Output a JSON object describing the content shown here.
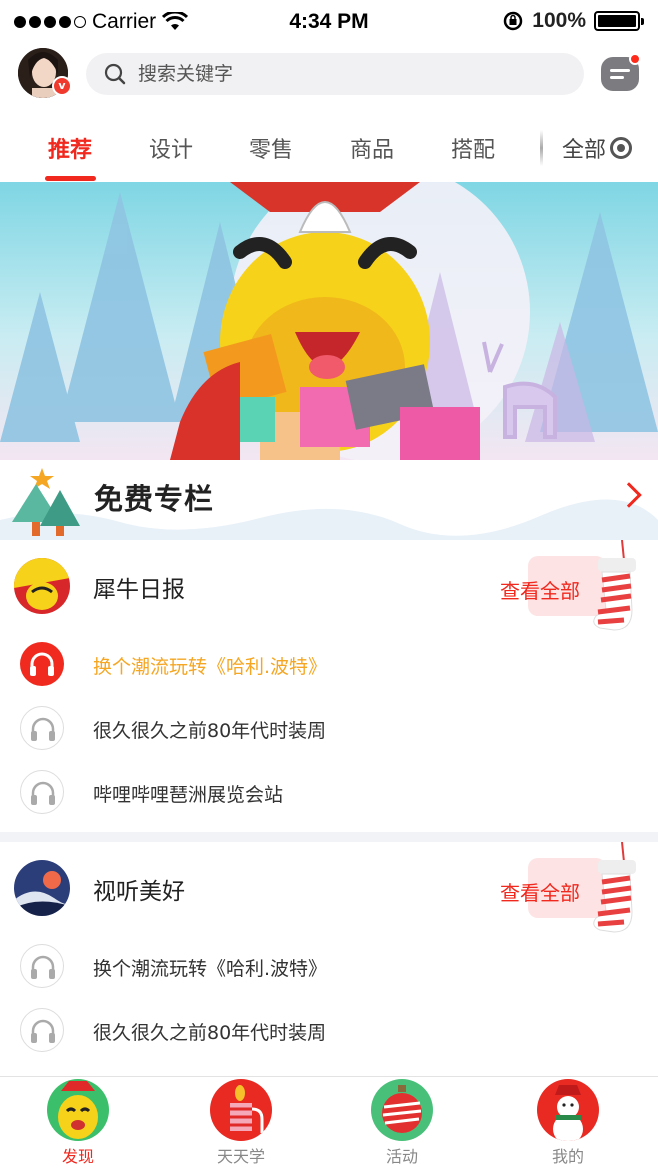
{
  "status_bar": {
    "carrier": "Carrier",
    "time": "4:34 PM",
    "battery": "100%"
  },
  "search": {
    "placeholder": "搜索关键字"
  },
  "tabs": [
    {
      "label": "推荐",
      "active": true
    },
    {
      "label": "设计"
    },
    {
      "label": "零售"
    },
    {
      "label": "商品"
    },
    {
      "label": "搭配"
    }
  ],
  "tab_all_label": "全部",
  "free_section": {
    "title": "免费专栏"
  },
  "columns": [
    {
      "title": "犀牛日报",
      "see_all": "查看全部",
      "tracks": [
        {
          "title": "换个潮流玩转《哈利.波特》",
          "playing": true
        },
        {
          "title": "很久很久之前80年代时装周"
        },
        {
          "title": "哔哩哔哩琶洲展览会站"
        }
      ]
    },
    {
      "title": "视听美好",
      "see_all": "查看全部",
      "tracks": [
        {
          "title": "换个潮流玩转《哈利.波特》"
        },
        {
          "title": "很久很久之前80年代时装周"
        }
      ]
    }
  ],
  "bottom_nav": [
    {
      "label": "发现",
      "active": true,
      "icon": "rhino-santa-icon"
    },
    {
      "label": "天天学",
      "icon": "gift-candle-icon"
    },
    {
      "label": "活动",
      "icon": "ornament-icon"
    },
    {
      "label": "我的",
      "icon": "snowman-icon"
    }
  ],
  "colors": {
    "accent": "#f0281e",
    "active_track": "#f5a623"
  }
}
